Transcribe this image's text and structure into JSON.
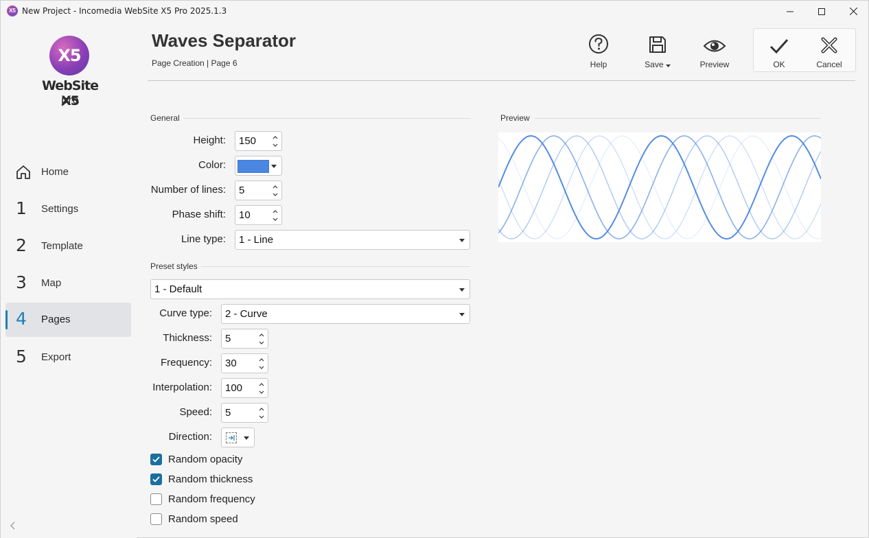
{
  "window": {
    "title": "New Project - Incomedia WebSite X5 Pro 2025.1.3",
    "icon_text": "X5"
  },
  "logo": {
    "mark": "X5",
    "brand": "WebSite X5",
    "edition": "pro"
  },
  "sidebar": {
    "items": [
      {
        "num": "",
        "label": "Home",
        "icon": "home-icon"
      },
      {
        "num": "1",
        "label": "Settings"
      },
      {
        "num": "2",
        "label": "Template"
      },
      {
        "num": "3",
        "label": "Map"
      },
      {
        "num": "4",
        "label": "Pages",
        "active": true
      },
      {
        "num": "5",
        "label": "Export"
      }
    ]
  },
  "header": {
    "title": "Waves Separator",
    "breadcrumb": "Page Creation | Page 6"
  },
  "toolbar": {
    "help": "Help",
    "save": "Save",
    "preview": "Preview",
    "ok": "OK",
    "cancel": "Cancel"
  },
  "general": {
    "section": "General",
    "height_label": "Height:",
    "height_value": "150",
    "color_label": "Color:",
    "color_value": "#4a86e2",
    "lines_label": "Number of lines:",
    "lines_value": "5",
    "phase_label": "Phase shift:",
    "phase_value": "10",
    "linetype_label": "Line type:",
    "linetype_value": "1 - Line"
  },
  "preset": {
    "section": "Preset styles",
    "style_value": "1 - Default",
    "curve_label": "Curve type:",
    "curve_value": "2 - Curve",
    "thickness_label": "Thickness:",
    "thickness_value": "5",
    "frequency_label": "Frequency:",
    "frequency_value": "30",
    "interp_label": "Interpolation:",
    "interp_value": "100",
    "speed_label": "Speed:",
    "speed_value": "5",
    "direction_label": "Direction:"
  },
  "checks": [
    {
      "label": "Random opacity",
      "checked": true
    },
    {
      "label": "Random thickness",
      "checked": true
    },
    {
      "label": "Random frequency",
      "checked": false
    },
    {
      "label": "Random speed",
      "checked": false
    }
  ],
  "preview": {
    "section": "Preview"
  },
  "colors": {
    "accent": "#1e7fb8",
    "wave": "#4a86e2",
    "checkbox": "#1b6f9e"
  }
}
